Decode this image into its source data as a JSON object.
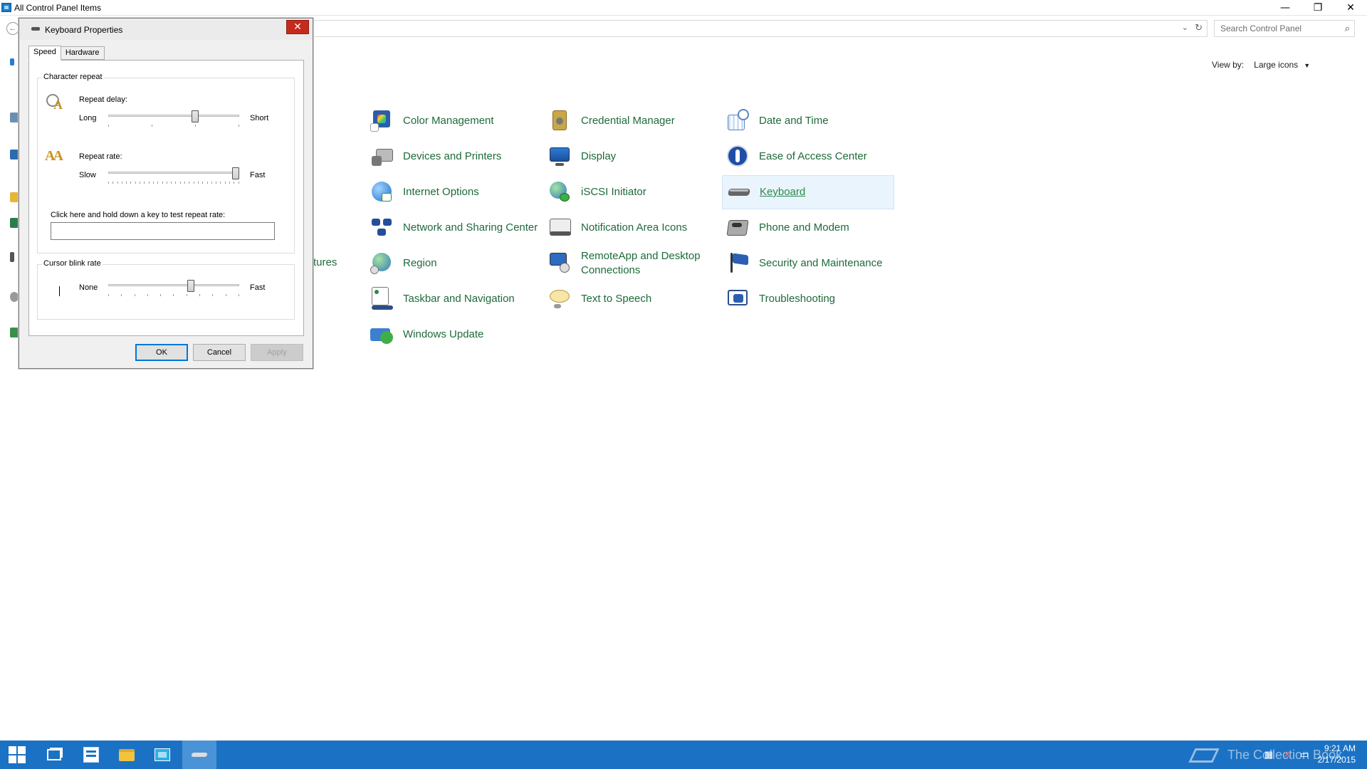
{
  "main_window": {
    "title": "All Control Panel Items",
    "controls": {
      "minimize": "—",
      "restore": "❐",
      "close": "✕"
    }
  },
  "address_bar": {
    "search_placeholder": "Search Control Panel"
  },
  "view_by": {
    "label": "View by:",
    "value": "Large icons"
  },
  "items": [
    {
      "label": "Color Management",
      "icon": "color-management-icon"
    },
    {
      "label": "Credential Manager",
      "icon": "credential-manager-icon"
    },
    {
      "label": "Date and Time",
      "icon": "date-time-icon"
    },
    {
      "label": "Devices and Printers",
      "icon": "devices-printers-icon"
    },
    {
      "label": "Display",
      "icon": "display-icon"
    },
    {
      "label": "Ease of Access Center",
      "icon": "ease-of-access-icon"
    },
    {
      "label": "Internet Options",
      "icon": "internet-options-icon"
    },
    {
      "label": "iSCSI Initiator",
      "icon": "iscsi-icon"
    },
    {
      "label": "Keyboard",
      "icon": "keyboard-icon",
      "selected": true
    },
    {
      "label": "Network and Sharing Center",
      "icon": "network-sharing-icon"
    },
    {
      "label": "Notification Area Icons",
      "icon": "notification-area-icon"
    },
    {
      "label": "Phone and Modem",
      "icon": "phone-modem-icon"
    },
    {
      "label": "Region",
      "icon": "region-icon"
    },
    {
      "label": "RemoteApp and Desktop Connections",
      "icon": "remoteapp-icon"
    },
    {
      "label": "Security and Maintenance",
      "icon": "security-maintenance-icon"
    },
    {
      "label": "Taskbar and Navigation",
      "icon": "taskbar-navigation-icon"
    },
    {
      "label": "Text to Speech",
      "icon": "text-to-speech-icon"
    },
    {
      "label": "Troubleshooting",
      "icon": "troubleshooting-icon"
    },
    {
      "label": "Windows Update",
      "icon": "windows-update-icon"
    }
  ],
  "partial_label": "tures",
  "dialog": {
    "title": "Keyboard Properties",
    "close": "✕",
    "tabs": [
      {
        "label": "Speed",
        "active": true
      },
      {
        "label": "Hardware",
        "active": false
      }
    ],
    "character_repeat": {
      "legend": "Character repeat",
      "repeat_delay": {
        "label": "Repeat delay:",
        "min_label": "Long",
        "max_label": "Short",
        "value_fraction": 0.67
      },
      "repeat_rate": {
        "label": "Repeat rate:",
        "min_label": "Slow",
        "max_label": "Fast",
        "value_fraction": 1.0
      },
      "test_label": "Click here and hold down a key to test repeat rate:",
      "test_value": ""
    },
    "cursor_blink": {
      "legend": "Cursor blink rate",
      "min_label": "None",
      "max_label": "Fast",
      "value_fraction": 0.64
    },
    "buttons": {
      "ok": "OK",
      "cancel": "Cancel",
      "apply": "Apply"
    }
  },
  "taskbar": {
    "items": [
      "start",
      "task-view",
      "server-manager",
      "file-explorer",
      "control-panel",
      "keyboard"
    ],
    "watermark": "The Collection Book",
    "clock": {
      "time": "9:21 AM",
      "date": "2/17/2015"
    }
  },
  "colors": {
    "link_green": "#1e6a3a",
    "taskbar_blue": "#1b72c4",
    "selection_bg": "#eaf4fd",
    "close_red": "#c42b1c"
  }
}
